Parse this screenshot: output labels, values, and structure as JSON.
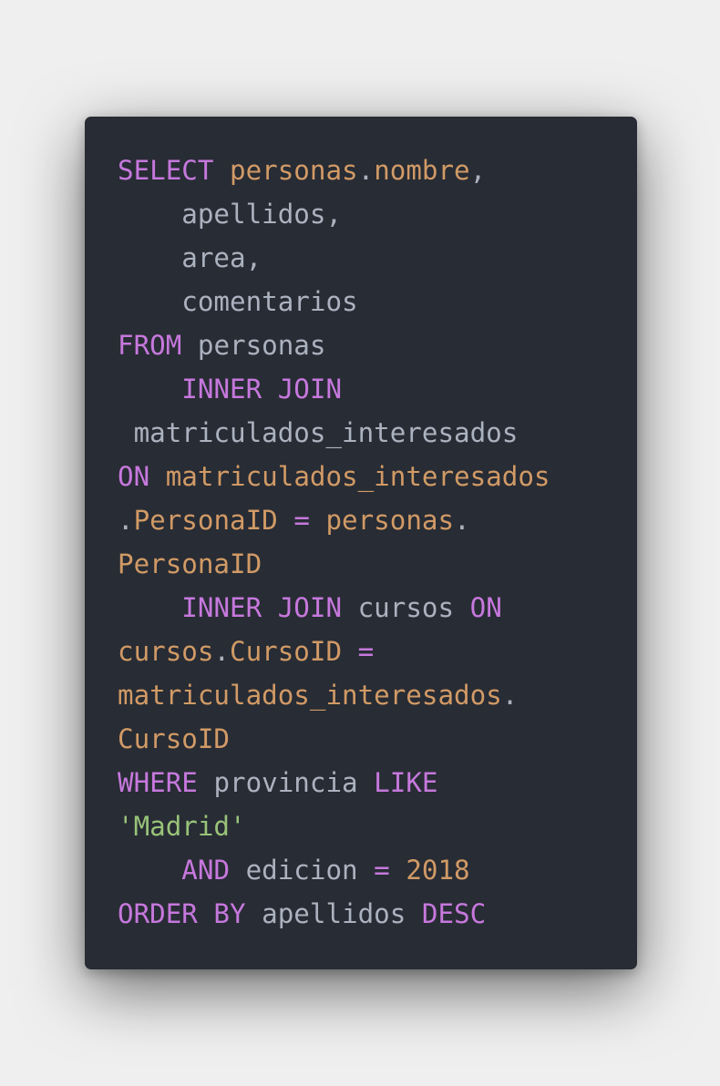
{
  "code": {
    "language": "SQL",
    "theme": "One Dark",
    "colors": {
      "background": "#282c34",
      "page_background": "#efefef",
      "keyword": "#c678dd",
      "identifier": "#abb2bf",
      "attribute": "#d19a66",
      "string": "#98c379",
      "number": "#d19a66"
    },
    "lines": [
      [
        {
          "t": "SELECT",
          "k": "kw"
        },
        {
          "t": " ",
          "k": "id"
        },
        {
          "t": "personas",
          "k": "attr"
        },
        {
          "t": ".",
          "k": "punct"
        },
        {
          "t": "nombre",
          "k": "attr"
        },
        {
          "t": ",",
          "k": "punct"
        }
      ],
      [
        {
          "t": "    apellidos,",
          "k": "id"
        }
      ],
      [
        {
          "t": "    area,",
          "k": "id"
        }
      ],
      [
        {
          "t": "    comentarios",
          "k": "id"
        }
      ],
      [
        {
          "t": "FROM",
          "k": "kw"
        },
        {
          "t": " personas",
          "k": "id"
        }
      ],
      [
        {
          "t": "    ",
          "k": "id"
        },
        {
          "t": "INNER JOIN",
          "k": "kw"
        }
      ],
      [
        {
          "t": " matriculados_interesados",
          "k": "id"
        }
      ],
      [
        {
          "t": "ON",
          "k": "kw"
        },
        {
          "t": " ",
          "k": "id"
        },
        {
          "t": "matriculados_interesados",
          "k": "attr"
        }
      ],
      [
        {
          "t": ".",
          "k": "punct"
        },
        {
          "t": "PersonaID",
          "k": "attr"
        },
        {
          "t": " ",
          "k": "id"
        },
        {
          "t": "=",
          "k": "op"
        },
        {
          "t": " ",
          "k": "id"
        },
        {
          "t": "personas",
          "k": "attr"
        },
        {
          "t": ".",
          "k": "punct"
        }
      ],
      [
        {
          "t": "PersonaID",
          "k": "attr"
        }
      ],
      [
        {
          "t": "    ",
          "k": "id"
        },
        {
          "t": "INNER JOIN",
          "k": "kw"
        },
        {
          "t": " cursos ",
          "k": "id"
        },
        {
          "t": "ON",
          "k": "kw"
        }
      ],
      [
        {
          "t": "cursos",
          "k": "attr"
        },
        {
          "t": ".",
          "k": "punct"
        },
        {
          "t": "CursoID",
          "k": "attr"
        },
        {
          "t": " ",
          "k": "id"
        },
        {
          "t": "=",
          "k": "op"
        }
      ],
      [
        {
          "t": "matriculados_interesados",
          "k": "attr"
        },
        {
          "t": ".",
          "k": "punct"
        }
      ],
      [
        {
          "t": "CursoID",
          "k": "attr"
        }
      ],
      [
        {
          "t": "WHERE",
          "k": "kw"
        },
        {
          "t": " provincia ",
          "k": "id"
        },
        {
          "t": "LIKE",
          "k": "kw"
        }
      ],
      [
        {
          "t": "'Madrid'",
          "k": "str"
        }
      ],
      [
        {
          "t": "    ",
          "k": "id"
        },
        {
          "t": "AND",
          "k": "kw"
        },
        {
          "t": " edicion ",
          "k": "id"
        },
        {
          "t": "=",
          "k": "op"
        },
        {
          "t": " ",
          "k": "id"
        },
        {
          "t": "2018",
          "k": "num"
        }
      ],
      [
        {
          "t": "ORDER BY",
          "k": "kw"
        },
        {
          "t": " apellidos ",
          "k": "id"
        },
        {
          "t": "DESC",
          "k": "kw"
        }
      ]
    ]
  }
}
